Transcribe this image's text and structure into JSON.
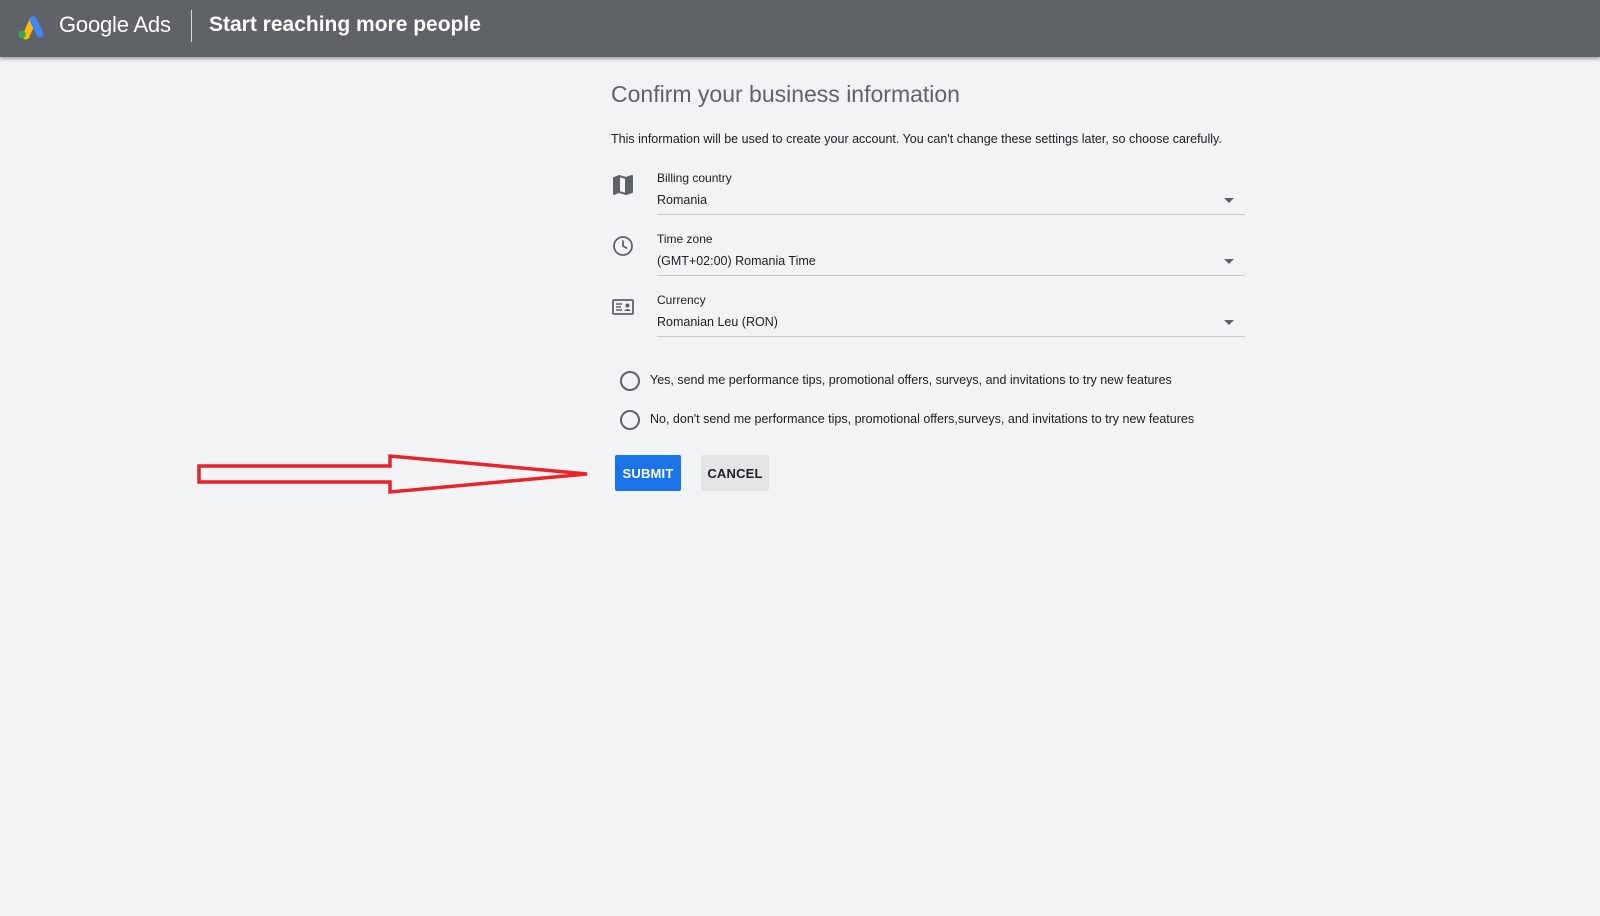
{
  "header": {
    "brand": "Google Ads",
    "title": "Start reaching more people",
    "background_color": "#5f6368",
    "logo_icon": "google-ads-logo"
  },
  "main": {
    "heading": "Confirm your business information",
    "intro": "This information will be used to create your account. You can't change these settings later, so choose carefully.",
    "fields": [
      {
        "label": "Billing country",
        "value": "Romania",
        "icon": "map-icon"
      },
      {
        "label": "Time zone",
        "value": "(GMT+02:00) Romania Time",
        "icon": "clock-icon"
      },
      {
        "label": "Currency",
        "value": "Romanian Leu (RON)",
        "icon": "currency-card-icon"
      }
    ],
    "radios": [
      {
        "label": "Yes, send me performance tips, promotional offers, surveys, and invitations to try new features",
        "selected": false
      },
      {
        "label": "No, don't send me performance tips, promotional offers,surveys, and invitations to try new features",
        "selected": false
      }
    ],
    "buttons": {
      "submit": "SUBMIT",
      "cancel": "CANCEL"
    }
  },
  "colors": {
    "primary": "#1a73e8",
    "page_background": "#f1f3f4",
    "annotation_arrow": "#e8232a"
  }
}
